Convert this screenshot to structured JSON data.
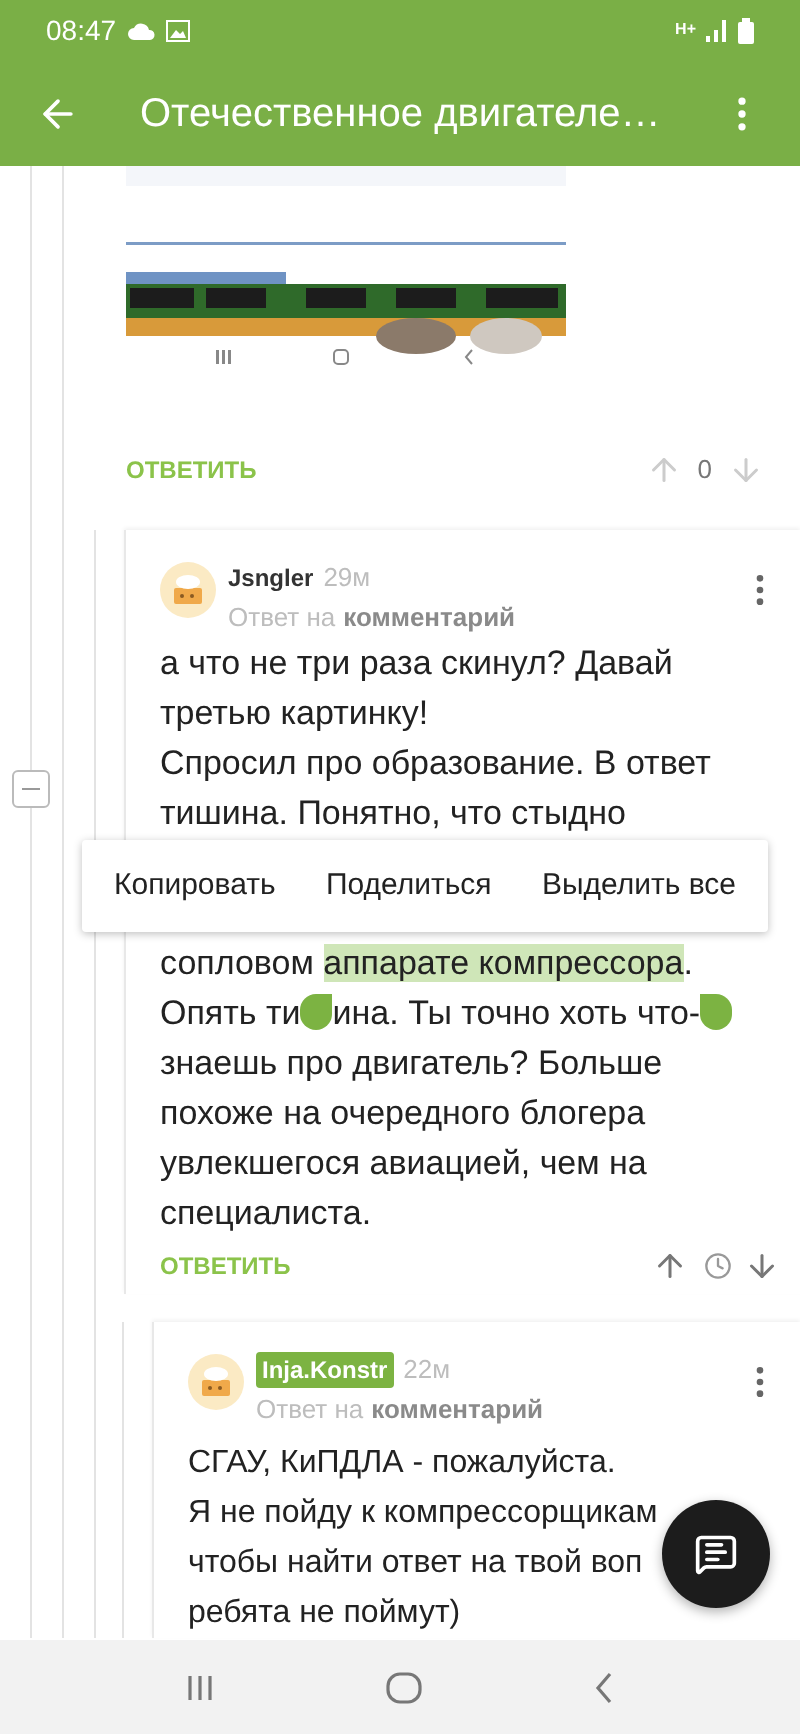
{
  "status_bar": {
    "time": "08:47",
    "network": "H+"
  },
  "app_bar": {
    "title": "Отечественное двигателе…"
  },
  "attachment": {
    "kind": "picture",
    "reply": "ОТВЕТИТЬ",
    "score": "0"
  },
  "comments": [
    {
      "author": "Jsngler",
      "author_highlighted": false,
      "time": "29м",
      "reply_prefix": "Ответ на",
      "reply_link": "комментарий",
      "blocks": [
        {
          "lines": [
            [
              {
                "text": "а что не три раза скинул? Давай",
                "selected": false
              }
            ],
            [
              {
                "text": "третью картинку!",
                "selected": false
              }
            ],
            [
              {
                "text": "Спросил про образование. В ответ",
                "selected": false
              }
            ],
            [
              {
                "text": "тишина. Понятно, что стыдно",
                "selected": false
              }
            ]
          ]
        },
        {
          "lines": [
            [
              {
                "text": "сопловом ",
                "selected": false
              },
              {
                "text": "аппарате компрессора",
                "selected": true
              },
              {
                "text": ".",
                "selected": false
              }
            ],
            [
              {
                "text": "Опять ти",
                "selected": false
              },
              {
                "kind": "handle_start"
              },
              {
                "text": "ина. Ты точно хоть что-",
                "selected": false
              },
              {
                "kind": "handle_end"
              }
            ],
            [
              {
                "text": "знаешь про двигатель? Больше",
                "selected": false
              }
            ],
            [
              {
                "text": "похоже на очередного блогера",
                "selected": false
              }
            ],
            [
              {
                "text": "увлекшегося авиацией, чем на",
                "selected": false
              }
            ],
            [
              {
                "text": "специалиста.",
                "selected": false
              }
            ]
          ]
        }
      ],
      "reply": "ОТВЕТИТЬ"
    },
    {
      "author": "Inja.Konstr",
      "author_highlighted": true,
      "time": "22м",
      "reply_prefix": "Ответ на",
      "reply_link": "комментарий",
      "blocks": [
        {
          "lines": [
            [
              {
                "text": "СГАУ, КиПДЛА - пожалуйста.",
                "selected": false
              }
            ],
            [
              {
                "text": "Я не пойду к компрессорщикам",
                "selected": false
              }
            ],
            [
              {
                "text": "чтобы найти ответ на твой воп",
                "selected": false
              }
            ],
            [
              {
                "text": "ребята не поймут)",
                "selected": false
              }
            ]
          ]
        }
      ]
    }
  ],
  "context_menu": [
    "Копировать",
    "Поделиться",
    "Выделить все"
  ]
}
